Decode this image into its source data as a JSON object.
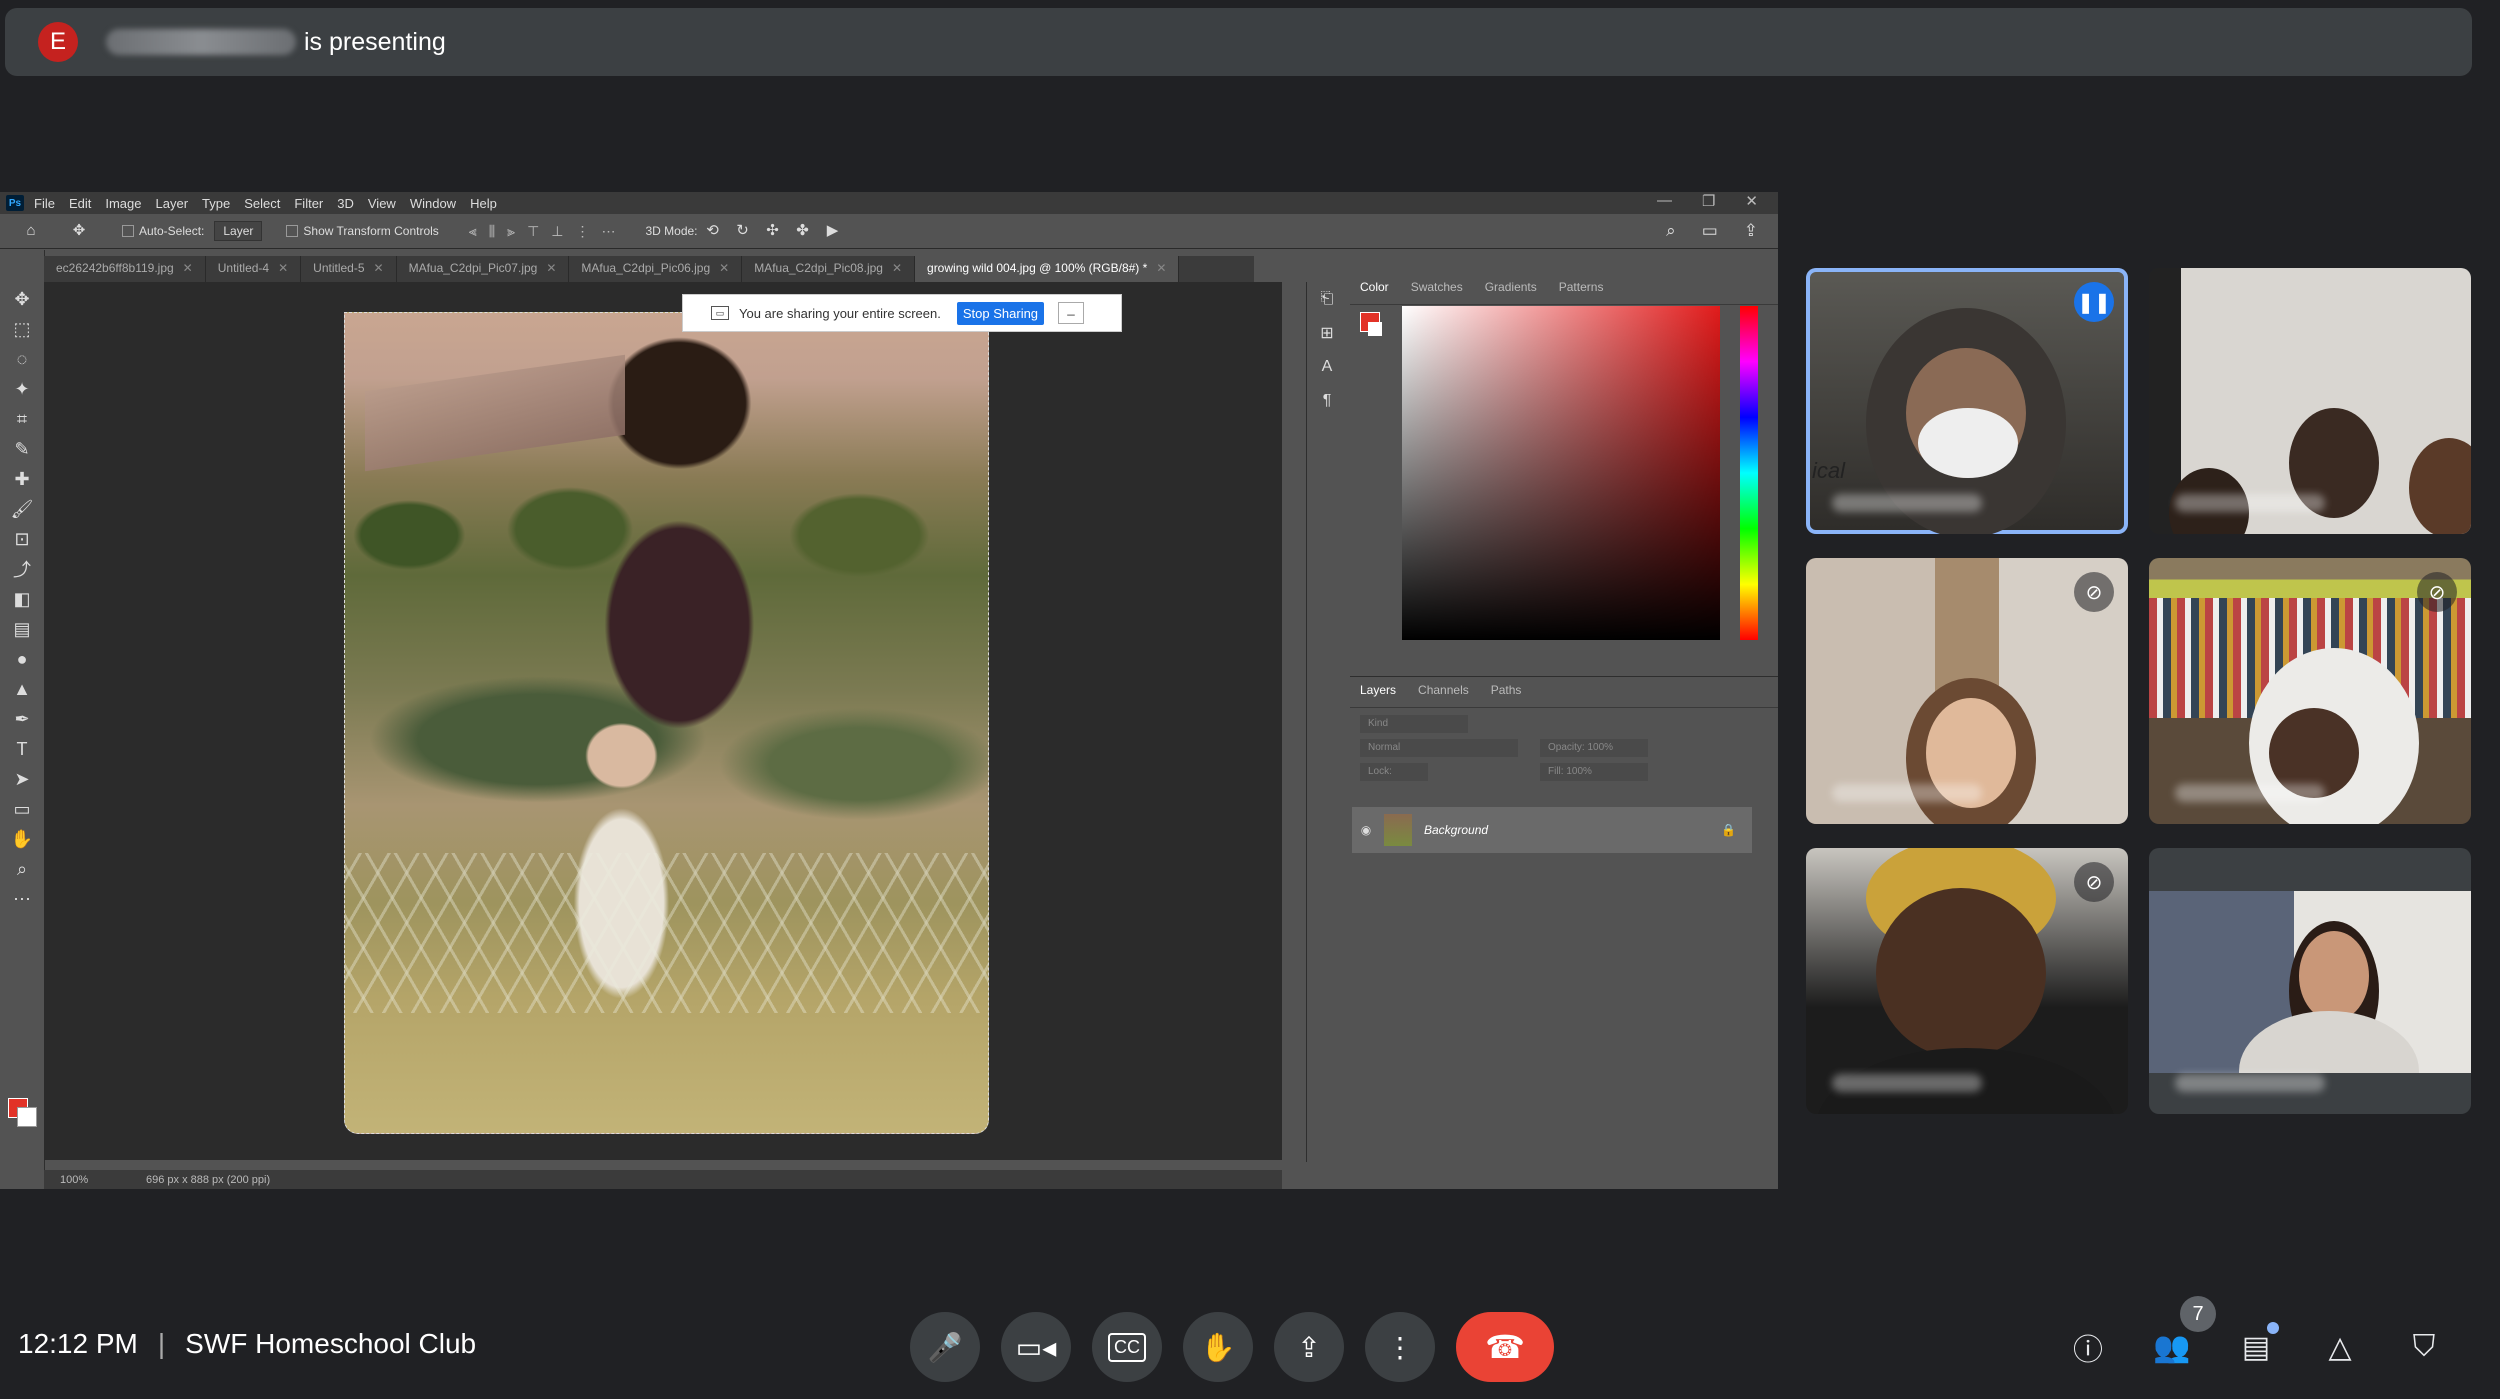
{
  "meet": {
    "presenter_initial": "E",
    "presenting_text": "is presenting",
    "time": "12:12 PM",
    "separator": "|",
    "meeting_name": "SWF Homeschool Club",
    "participant_count": "7"
  },
  "photoshop": {
    "logo": "Ps",
    "menu": [
      "File",
      "Edit",
      "Image",
      "Layer",
      "Type",
      "Select",
      "Filter",
      "3D",
      "View",
      "Window",
      "Help"
    ],
    "window_controls": [
      "—",
      "❐",
      "✕"
    ],
    "options": {
      "auto_select": "Auto-Select:",
      "layer_select": "Layer",
      "show_transform": "Show Transform Controls",
      "mode_3d": "3D Mode:"
    },
    "tabs": [
      {
        "label": "ec26242b6ff8b119.jpg",
        "active": false
      },
      {
        "label": "Untitled-4",
        "active": false
      },
      {
        "label": "Untitled-5",
        "active": false
      },
      {
        "label": "MAfua_C2dpi_Pic07.jpg",
        "active": false
      },
      {
        "label": "MAfua_C2dpi_Pic06.jpg",
        "active": false
      },
      {
        "label": "MAfua_C2dpi_Pic08.jpg",
        "active": false
      },
      {
        "label": "growing wild 004.jpg @ 100% (RGB/8#) *",
        "active": true
      }
    ],
    "sharebar": {
      "message": "You are sharing your entire screen.",
      "stop_label": "Stop Sharing",
      "minimize": "_"
    },
    "status": {
      "zoom": "100%",
      "dimensions": "696 px x 888 px (200 ppi)"
    },
    "color_tabs": [
      "Color",
      "Swatches",
      "Gradients",
      "Patterns"
    ],
    "layer_tabs": [
      "Layers",
      "Channels",
      "Paths"
    ],
    "layers_fields": {
      "kind": "Kind",
      "blend": "Normal",
      "opacity": "Opacity: 100%",
      "lock": "Lock:",
      "fill": "Fill: 100%"
    },
    "layer_name": "Background",
    "colors": {
      "foreground": "#e23227",
      "background": "#ffffff"
    }
  },
  "tiles": [
    {
      "id": "tile-1",
      "speaking": true,
      "muted": false,
      "overlay_text": "ical"
    },
    {
      "id": "tile-2",
      "speaking": false,
      "muted": false
    },
    {
      "id": "tile-3",
      "speaking": false,
      "muted": true
    },
    {
      "id": "tile-4",
      "speaking": false,
      "muted": true
    },
    {
      "id": "tile-5",
      "speaking": false,
      "muted": true
    },
    {
      "id": "tile-6",
      "speaking": false,
      "muted": false
    }
  ],
  "icons": {
    "mic": "mic-icon",
    "camera": "camera-icon",
    "captions": "captions-icon",
    "hand": "raise-hand-icon",
    "present": "present-icon",
    "more": "more-options-icon",
    "end": "end-call-icon",
    "info": "info-icon",
    "people": "people-icon",
    "chat": "chat-icon",
    "activities": "activities-icon",
    "safety": "host-controls-icon"
  },
  "labels": {
    "cc": "CC"
  }
}
